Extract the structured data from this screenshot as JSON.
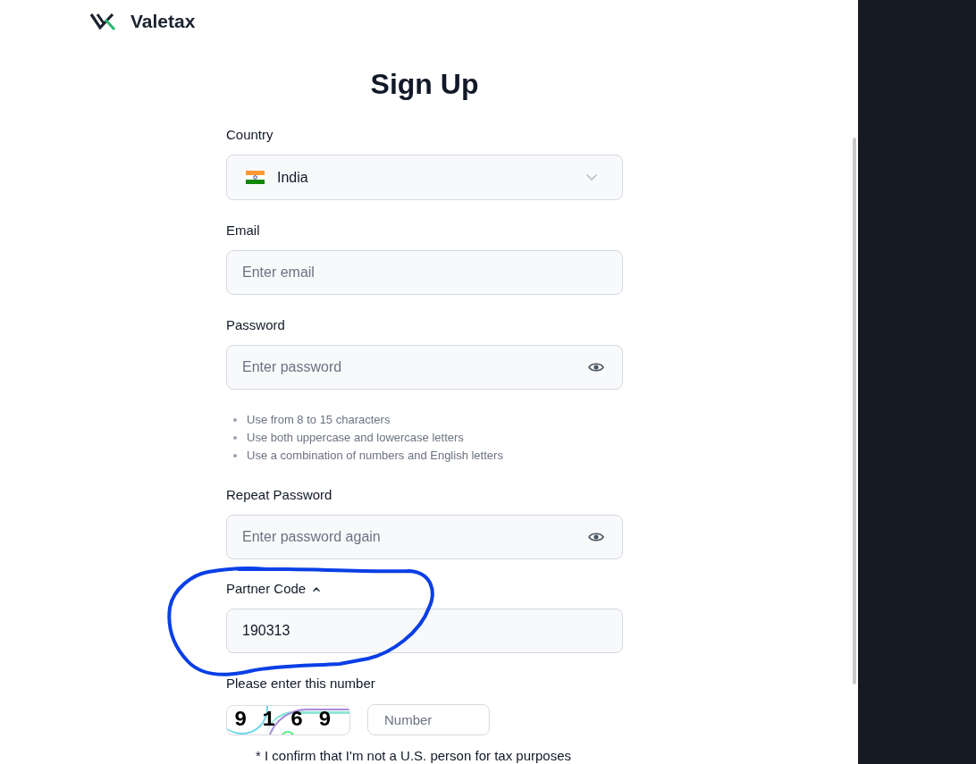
{
  "header": {
    "logo_text": "Valetax"
  },
  "title": "Sign Up",
  "fields": [
    {
      "kind": "select",
      "label": "Country",
      "value": "India"
    },
    {
      "kind": "email",
      "label": "Email",
      "placeholder": "Enter email"
    },
    {
      "kind": "password",
      "label": "Password",
      "placeholder": "Enter password",
      "hints": [
        "Use from 8 to 15 characters",
        "Use both uppercase and lowercase letters",
        "Use a combination of numbers and English letters"
      ]
    },
    {
      "kind": "password",
      "label": "Repeat Password",
      "placeholder": "Enter password again"
    }
  ],
  "partner_code": {
    "label": "Partner Code",
    "expanded": true,
    "value": "190313"
  },
  "captcha": {
    "label": "Please enter this number",
    "code": "9169",
    "placeholder": "Number"
  },
  "confirmation": "* I confirm that I'm not a U.S. person for tax purposes"
}
